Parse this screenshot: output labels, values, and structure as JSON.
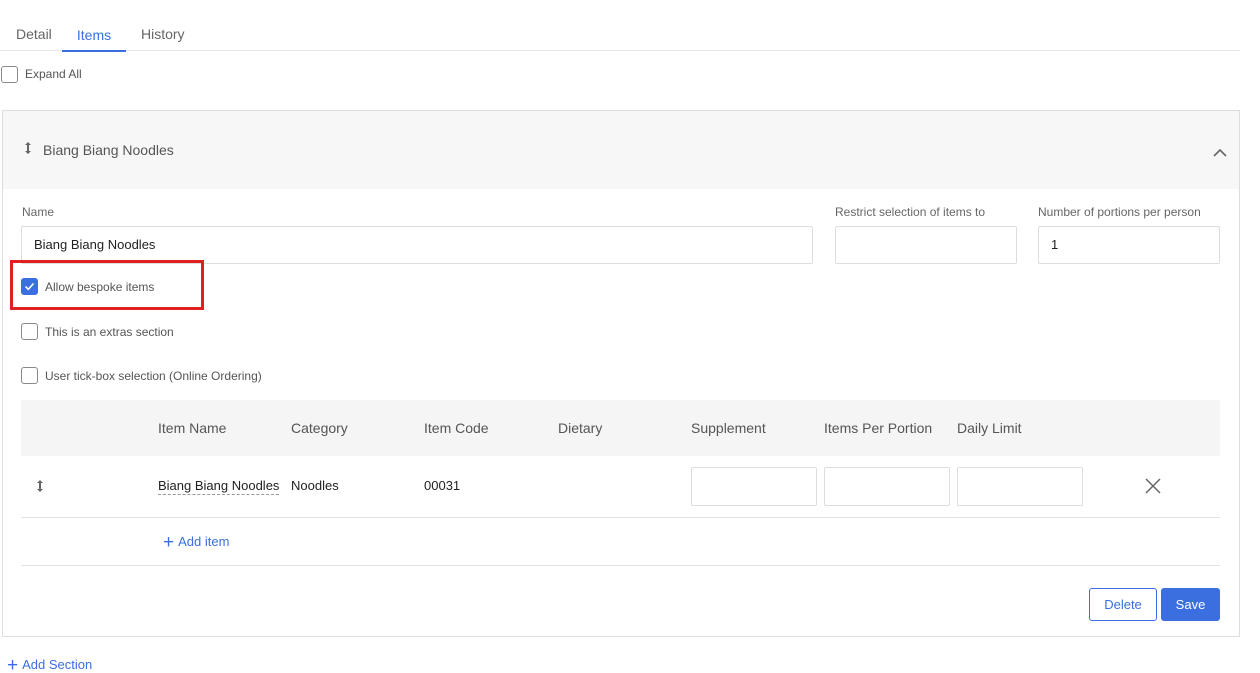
{
  "tabs": [
    {
      "label": "Detail"
    },
    {
      "label": "Items",
      "active": true
    },
    {
      "label": "History"
    }
  ],
  "expand_all": {
    "label": "Expand All",
    "checked": false
  },
  "section": {
    "title": "Biang Biang Noodles",
    "fields": {
      "name_label": "Name",
      "name_value": "Biang Biang Noodles",
      "restrict_label": "Restrict selection of items to",
      "restrict_value": "",
      "portions_label": "Number of portions per person",
      "portions_value": "1"
    },
    "options": [
      {
        "label": "Allow bespoke items",
        "checked": true
      },
      {
        "label": "This is an extras section",
        "checked": false
      },
      {
        "label": "User tick-box selection (Online Ordering)",
        "checked": false
      }
    ],
    "table": {
      "columns": [
        "Item Name",
        "Category",
        "Item Code",
        "Dietary",
        "Supplement",
        "Items Per Portion",
        "Daily Limit"
      ],
      "rows": [
        {
          "item_name": "Biang Biang Noodles",
          "category": "Noodles",
          "item_code": "00031",
          "dietary": "",
          "supplement": "",
          "items_per_portion": "",
          "daily_limit": ""
        }
      ]
    },
    "add_item_label": "Add item",
    "delete_label": "Delete",
    "save_label": "Save"
  },
  "add_section_label": "Add Section",
  "colors": {
    "accent": "#3b6fe0",
    "highlight": "#e02020"
  },
  "icons": [
    "drag-handle-icon",
    "chevron-up-icon",
    "check-icon",
    "close-icon",
    "plus-icon"
  ]
}
